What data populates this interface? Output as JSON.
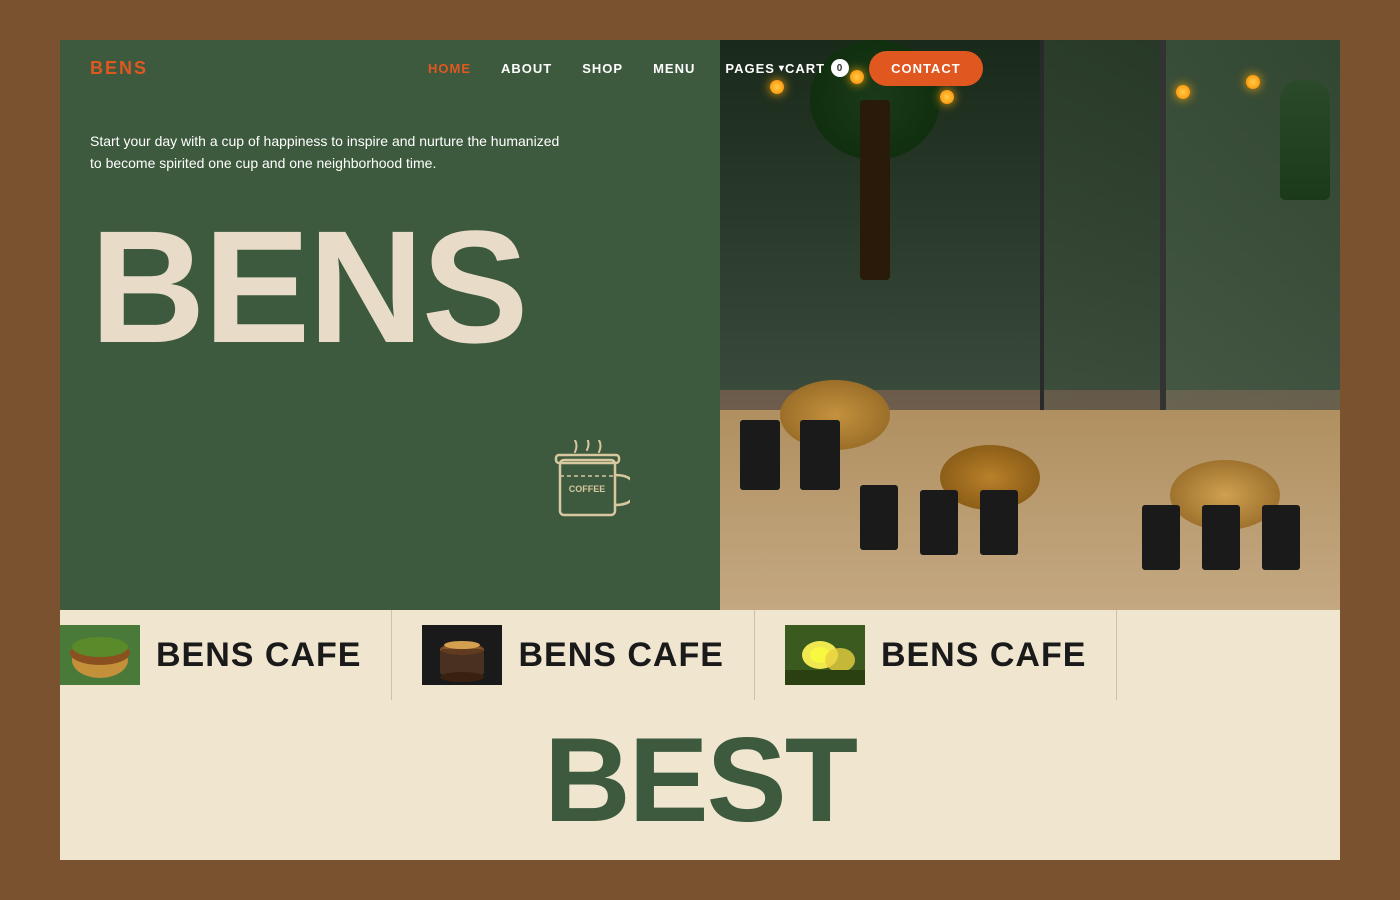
{
  "site": {
    "logo": "BENS",
    "background_color": "#7a5230"
  },
  "navbar": {
    "logo": "BENS",
    "links": [
      {
        "label": "HOME",
        "active": true
      },
      {
        "label": "ABOUT",
        "active": false
      },
      {
        "label": "SHOP",
        "active": false
      },
      {
        "label": "MENU",
        "active": false
      },
      {
        "label": "PAGES",
        "active": false,
        "has_dropdown": true
      }
    ],
    "cart_label": "CART",
    "cart_count": "0",
    "contact_label": "CONTACT"
  },
  "hero": {
    "tagline": "Start your day with a cup of happiness to inspire and nurture the humanized to become spirited one cup and one neighborhood time.",
    "title": "BENS"
  },
  "ticker": {
    "items": [
      {
        "label": "BENS CAFE"
      },
      {
        "label": "BENS CAFE"
      },
      {
        "label": "BENS CAFE"
      }
    ]
  },
  "best_section": {
    "title": "BEST"
  },
  "icons": {
    "chevron_down": "▾",
    "cart_icon": "🛒"
  }
}
